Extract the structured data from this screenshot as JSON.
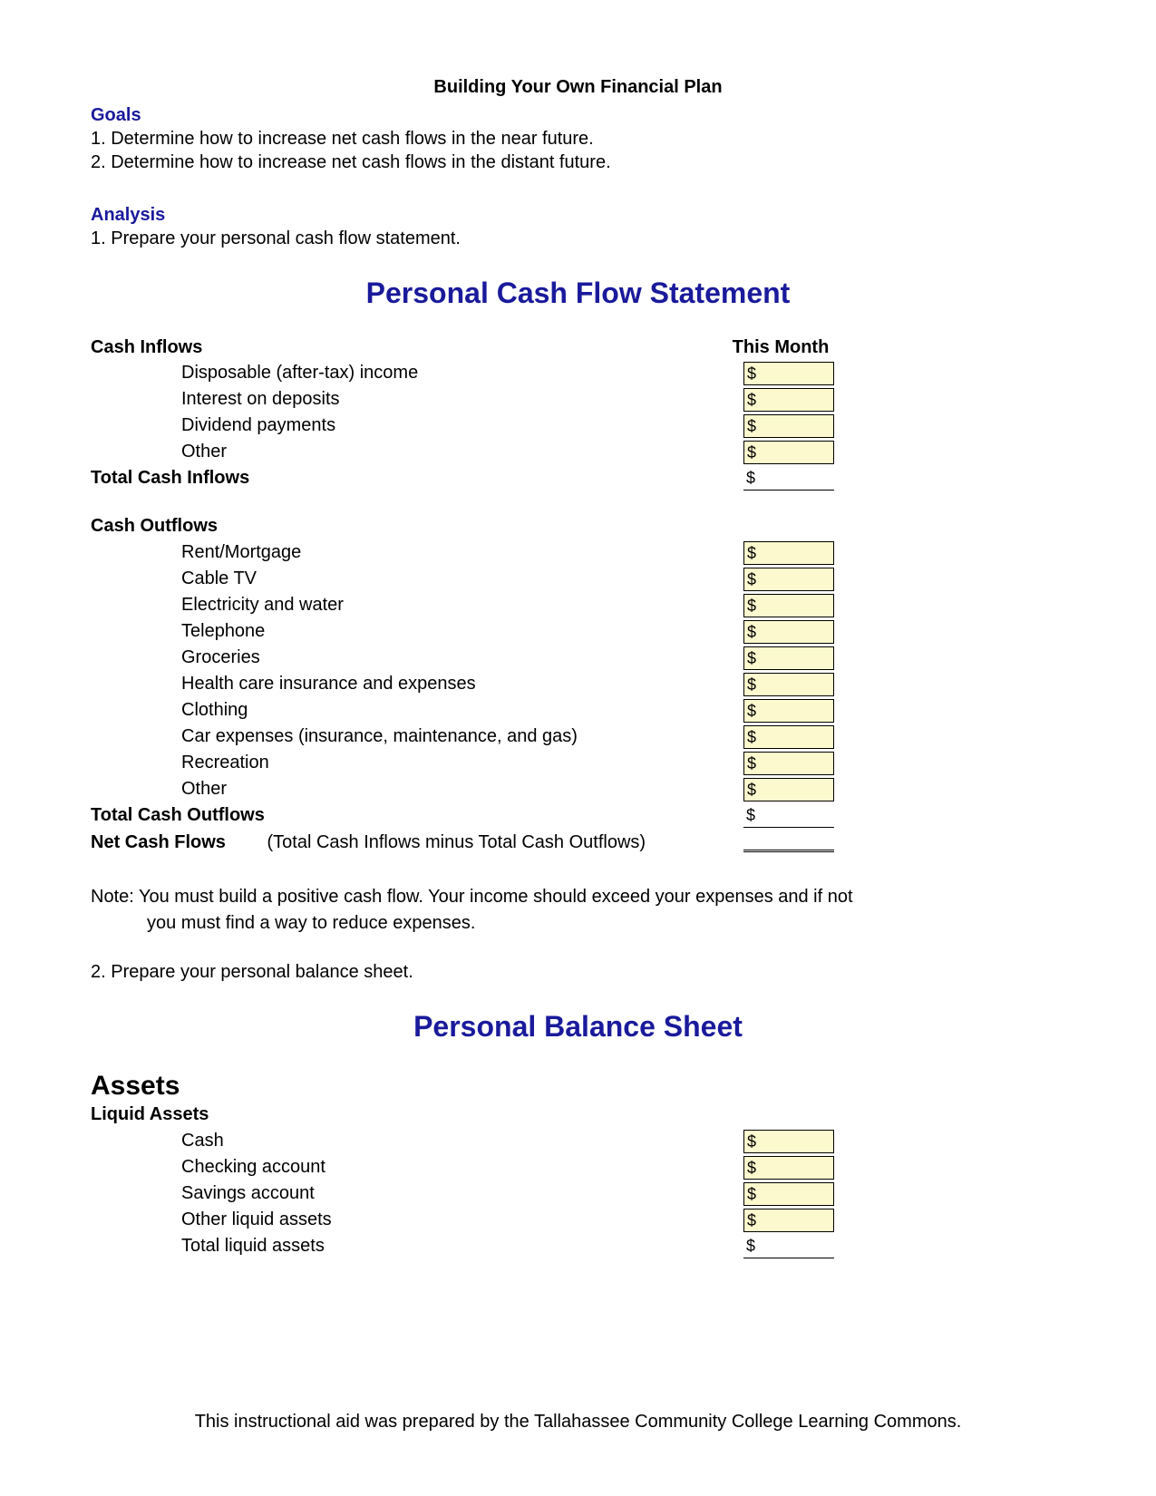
{
  "doc_title": "Building Your Own Financial Plan",
  "goals": {
    "heading": "Goals",
    "items": [
      "1. Determine how to increase net cash flows in the near future.",
      "2. Determine how to increase net cash flows in the distant future."
    ]
  },
  "analysis": {
    "heading": "Analysis",
    "item1": "1. Prepare your personal cash flow statement."
  },
  "cashflow": {
    "title": "Personal Cash Flow Statement",
    "inflows_heading": "Cash Inflows",
    "this_month": "This Month",
    "inflow_items": [
      "Disposable (after-tax) income",
      "Interest on deposits",
      "Dividend payments",
      "Other"
    ],
    "total_inflows": "Total Cash Inflows",
    "outflows_heading": "Cash Outflows",
    "outflow_items": [
      "Rent/Mortgage",
      "Cable TV",
      "Electricity and water",
      "Telephone",
      "Groceries",
      "Health care insurance and expenses",
      "Clothing",
      "Car expenses (insurance, maintenance, and gas)",
      "Recreation",
      "Other"
    ],
    "total_outflows": "Total Cash Outflows",
    "net_label": "Net Cash Flows",
    "net_note": "(Total Cash Inflows minus Total Cash Outflows)",
    "dollar": "$"
  },
  "note": {
    "line1": "Note: You must build a positive cash flow.  Your income should exceed your expenses and if not",
    "line2": "you must find a way to reduce expenses."
  },
  "step2": "2. Prepare your personal balance sheet.",
  "balance": {
    "title": "Personal Balance Sheet",
    "assets_heading": "Assets",
    "liquid_heading": "Liquid Assets",
    "liquid_items": [
      "Cash",
      "Checking account",
      "Savings account",
      "Other liquid assets"
    ],
    "total_liquid": "Total liquid assets"
  },
  "footer": "This instructional aid was prepared by the Tallahassee Community College Learning Commons."
}
